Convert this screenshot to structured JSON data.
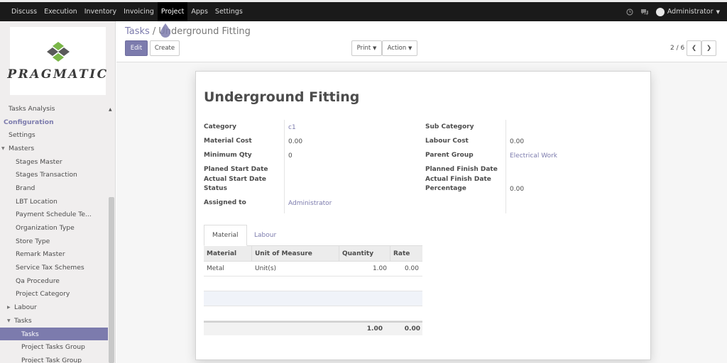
{
  "topbar": {
    "menu": [
      {
        "label": "Discuss",
        "active": false
      },
      {
        "label": "Execution",
        "active": false
      },
      {
        "label": "Inventory",
        "active": false
      },
      {
        "label": "Invoicing",
        "active": false
      },
      {
        "label": "Project",
        "active": true
      },
      {
        "label": "Apps",
        "active": false
      },
      {
        "label": "Settings",
        "active": false
      }
    ],
    "user": "Administrator"
  },
  "sidebar": {
    "logo_text": "PRAGMATIC",
    "items": [
      {
        "label": "Tasks Analysis",
        "style": "lvl0"
      },
      {
        "label": "Configuration",
        "style": "header"
      },
      {
        "label": "Settings",
        "style": "lvl0"
      },
      {
        "label": "Masters",
        "style": "tree",
        "expanded": true
      },
      {
        "label": "Stages Master",
        "style": "lvl1"
      },
      {
        "label": "Stages Transaction",
        "style": "lvl1"
      },
      {
        "label": "Brand",
        "style": "lvl1"
      },
      {
        "label": "LBT Location",
        "style": "lvl1"
      },
      {
        "label": "Payment Schedule Te...",
        "style": "lvl1"
      },
      {
        "label": "Organization Type",
        "style": "lvl1"
      },
      {
        "label": "Store Type",
        "style": "lvl1"
      },
      {
        "label": "Remark Master",
        "style": "lvl1"
      },
      {
        "label": "Service Tax Schemes",
        "style": "lvl1"
      },
      {
        "label": "Qa Procedure",
        "style": "lvl1"
      },
      {
        "label": "Project Category",
        "style": "lvl1"
      },
      {
        "label": "Labour",
        "style": "tree2",
        "expanded": false
      },
      {
        "label": "Tasks",
        "style": "tree2",
        "expanded": true
      },
      {
        "label": "Tasks",
        "style": "lvl2",
        "active": true
      },
      {
        "label": "Project Tasks Group",
        "style": "lvl2"
      },
      {
        "label": "Project Task Group",
        "style": "lvl2"
      }
    ]
  },
  "control": {
    "breadcrumb_parent": "Tasks",
    "breadcrumb_current": "Underground Fitting",
    "edit_label": "Edit",
    "create_label": "Create",
    "print_label": "Print",
    "action_label": "Action",
    "pager": "2 / 6"
  },
  "form": {
    "title": "Underground Fitting",
    "left": {
      "category_label": "Category",
      "category_value": "c1",
      "material_cost_label": "Material Cost",
      "material_cost_value": "0.00",
      "minimum_qty_label": "Minimum Qty",
      "minimum_qty_value": "0",
      "planned_start_label": "Planed Start Date",
      "actual_start_label": "Actual Start Date",
      "status_label": "Status",
      "assigned_to_label": "Assigned to",
      "assigned_to_value": "Administrator"
    },
    "right": {
      "sub_category_label": "Sub Category",
      "labour_cost_label": "Labour Cost",
      "labour_cost_value": "0.00",
      "parent_group_label": "Parent Group",
      "parent_group_value": "Electrical Work",
      "planned_finish_label": "Planned Finish Date",
      "actual_finish_label": "Actual Finish Date",
      "percentage_label": "Percentage",
      "percentage_value": "0.00"
    },
    "tabs": [
      {
        "label": "Material",
        "active": true
      },
      {
        "label": "Labour",
        "active": false
      }
    ],
    "table": {
      "columns": [
        "Material",
        "Unit of Measure",
        "Quantity",
        "Rate"
      ],
      "rows": [
        {
          "material": "Metal",
          "uom": "Unit(s)",
          "quantity": "1.00",
          "rate": "0.00"
        }
      ],
      "totals": {
        "quantity": "1.00",
        "rate": "0.00"
      }
    }
  },
  "colors": {
    "accent": "#7c7bad",
    "topbar": "#1a1a1a",
    "sidebar": "#f0eeee"
  }
}
